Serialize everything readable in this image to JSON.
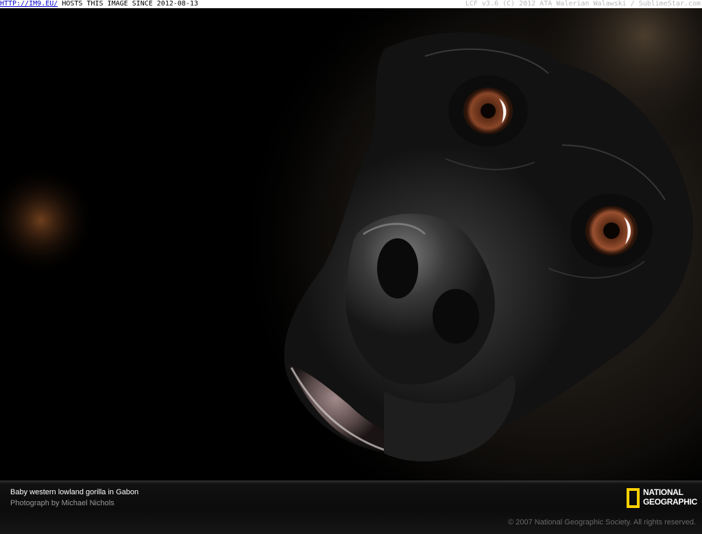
{
  "banner": {
    "host_link": "HTTP://IM9.EU/",
    "host_text": " HOSTS THIS IMAGE SINCE 2012-08-13",
    "right_text": "LCF v3.6 (C) 2012 ATA Walerian Walawski / SublimeStar.com"
  },
  "photo": {
    "subject": "baby-gorilla-face"
  },
  "caption": {
    "title": "Baby western lowland gorilla in Gabon",
    "credit": "Photograph by Michael Nichols",
    "copyright": "© 2007 National Geographic Society. All rights reserved."
  },
  "logo": {
    "line1": "NATIONAL",
    "line2": "GEOGRAPHIC",
    "frame_color": "#ffd200"
  }
}
